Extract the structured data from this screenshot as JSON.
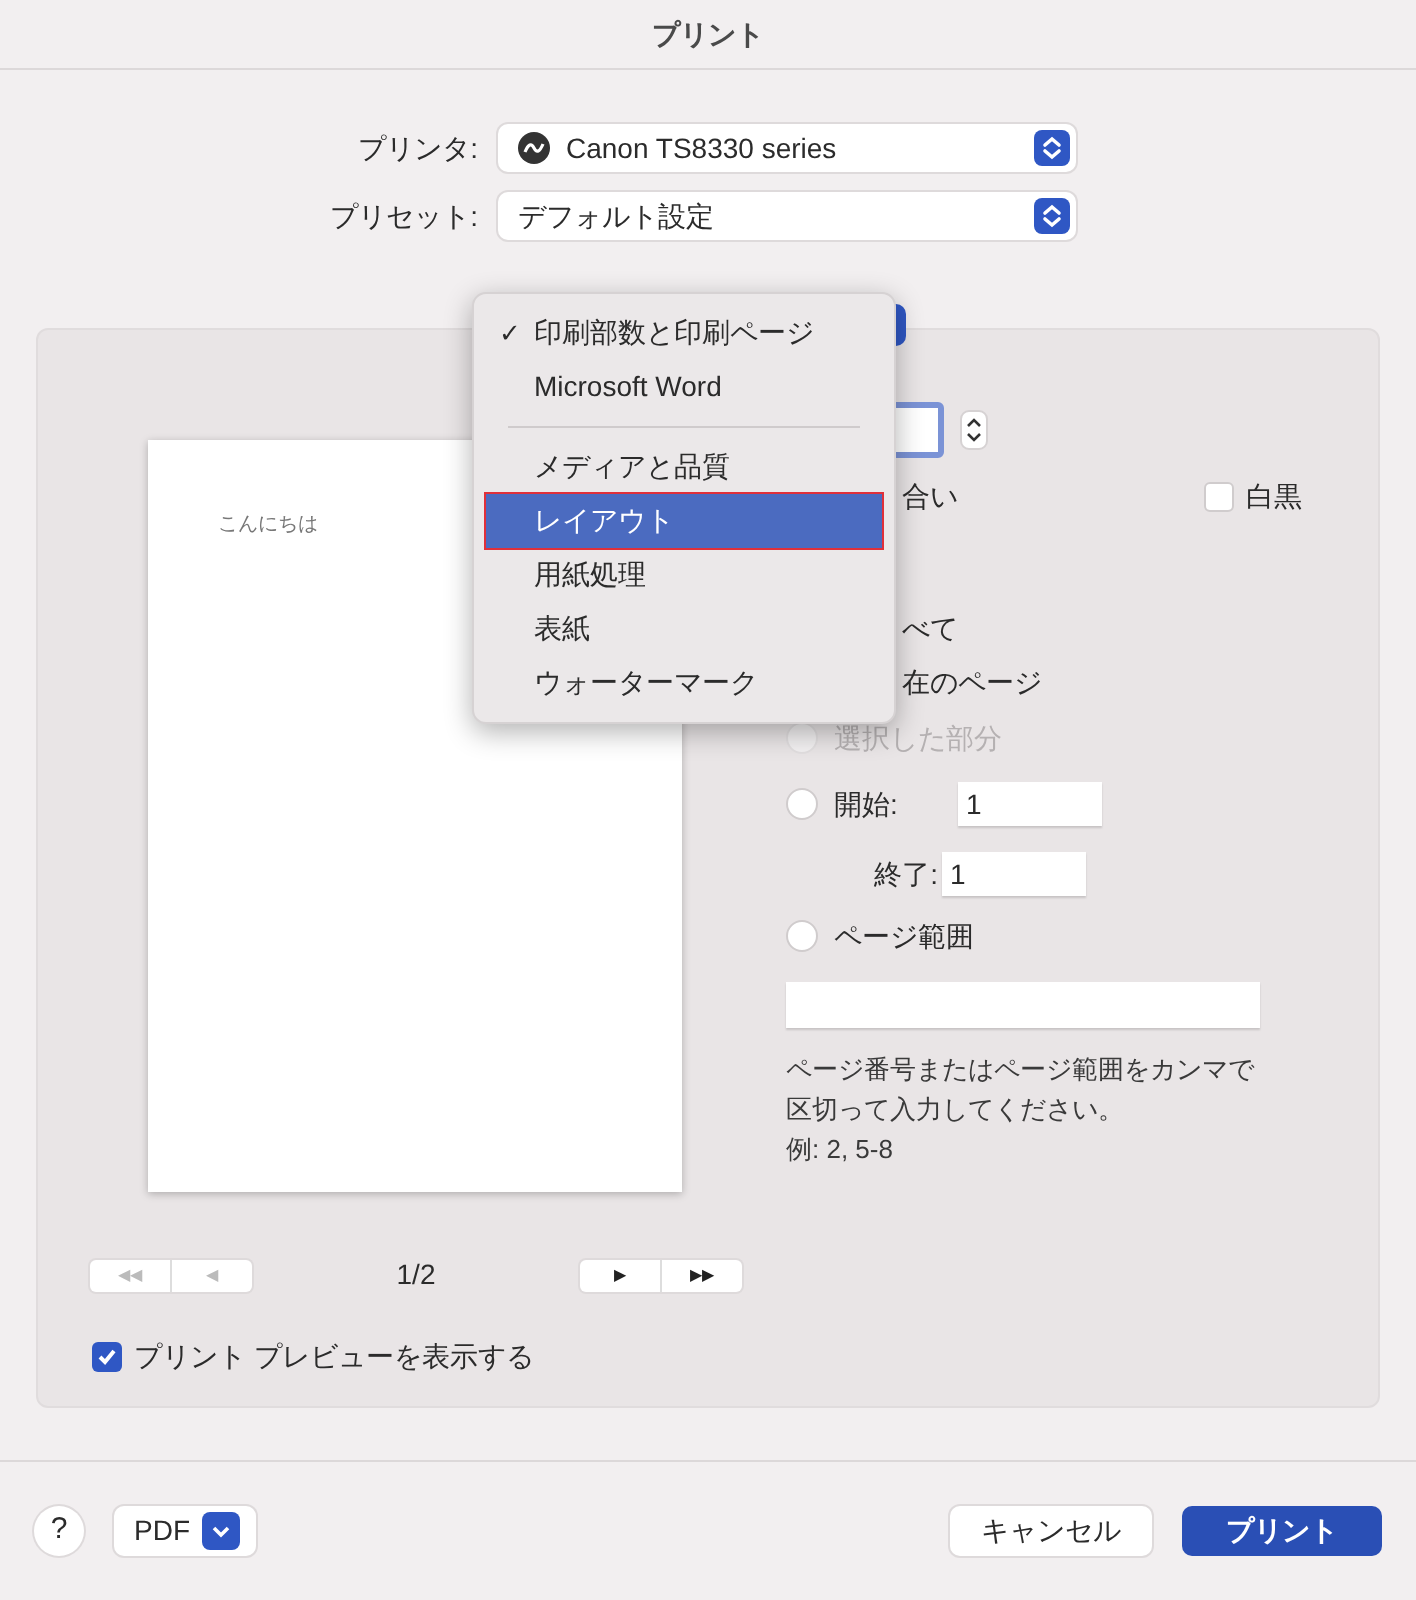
{
  "window": {
    "title": "プリント"
  },
  "printer": {
    "label": "プリンタ:",
    "value": "Canon TS8330 series"
  },
  "preset": {
    "label": "プリセット:",
    "value": "デフォルト設定"
  },
  "section_menu": {
    "check_glyph": "✓",
    "items": [
      {
        "kind": "item",
        "label": "印刷部数と印刷ページ",
        "checked": true,
        "selected": false
      },
      {
        "kind": "item",
        "label": "Microsoft Word",
        "checked": false,
        "selected": false
      },
      {
        "kind": "separator"
      },
      {
        "kind": "item",
        "label": "メディアと品質",
        "checked": false,
        "selected": false
      },
      {
        "kind": "item",
        "label": "レイアウト",
        "checked": false,
        "selected": true
      },
      {
        "kind": "item",
        "label": "用紙処理",
        "checked": false,
        "selected": false
      },
      {
        "kind": "item",
        "label": "表紙",
        "checked": false,
        "selected": false
      },
      {
        "kind": "item",
        "label": "ウォーターマーク",
        "checked": false,
        "selected": false
      }
    ]
  },
  "preview": {
    "page_text": "こんにちは",
    "page_indicator": "1/2",
    "nav": [
      {
        "glyph": "◀◀",
        "disabled": true
      },
      {
        "glyph": "◀",
        "disabled": true
      },
      {
        "glyph": "▶",
        "disabled": false
      },
      {
        "glyph": "▶▶",
        "disabled": false
      }
    ],
    "show_preview": {
      "label": "プリント プレビューを表示する",
      "checked": true
    }
  },
  "options": {
    "collate_label": "合い",
    "black_white": {
      "label": "白黒",
      "checked": false
    },
    "partial_labels": [
      "べて",
      "在のページ"
    ],
    "selection": {
      "label": "選択した部分",
      "selected": false,
      "disabled": true
    },
    "from": {
      "label": "開始:",
      "value": "1",
      "selected": false
    },
    "to": {
      "label": "終了:",
      "value": "1"
    },
    "range": {
      "label": "ページ範囲",
      "selected": false
    },
    "hint": "ページ番号またはページ範囲をカンマで区切って入力してください。",
    "example": "例: 2, 5-8"
  },
  "footer": {
    "help": "?",
    "pdf": "PDF",
    "cancel": "キャンセル",
    "print": "プリント"
  }
}
